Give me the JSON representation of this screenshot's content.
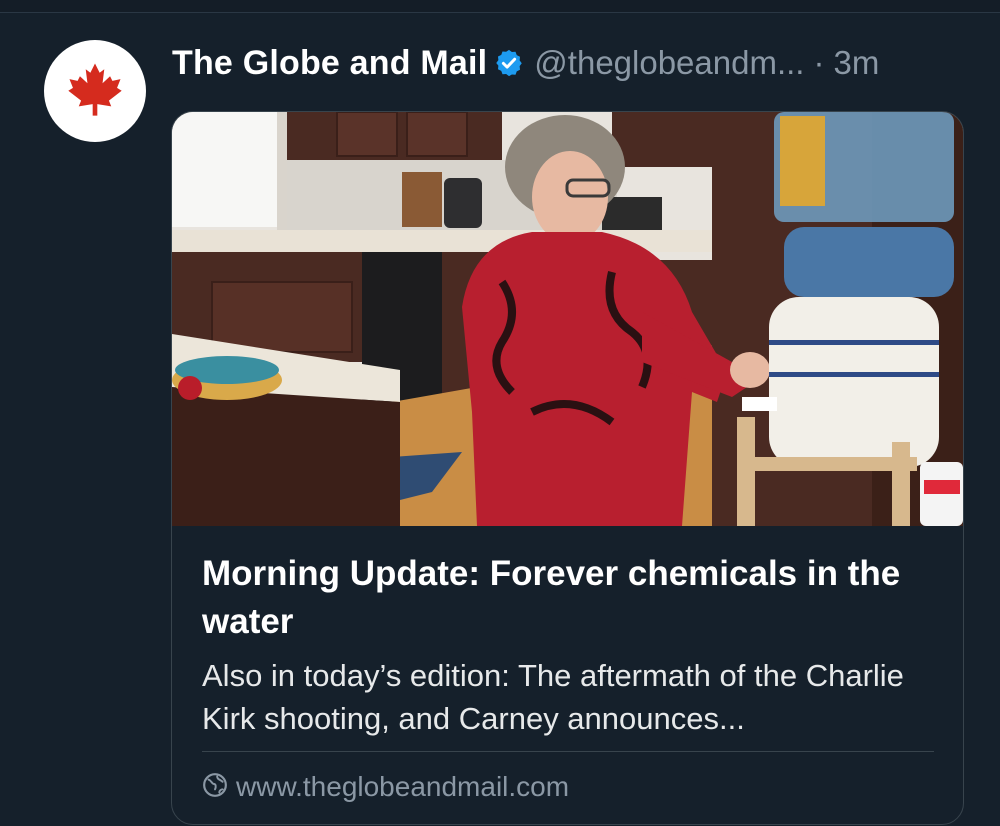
{
  "post": {
    "author_name": "The Globe and Mail",
    "handle": "@theglobeandm...",
    "separator": "·",
    "time_ago": "3m",
    "avatar_icon": "maple-leaf-icon",
    "verified_icon": "verified-badge-icon"
  },
  "card": {
    "image_icon": "article-photo",
    "title": "Morning Update: Forever chemicals in the water",
    "description": "Also in today’s edition: The aftermath of the Charlie Kirk shooting, and Carney announces...",
    "domain": "www.theglobeandmail.com",
    "domain_icon": "globe-icon"
  },
  "colors": {
    "background": "#15202b",
    "verified_blue": "#1d9bf0",
    "maple_red": "#d52b1e",
    "muted_text": "#8b98a5"
  }
}
